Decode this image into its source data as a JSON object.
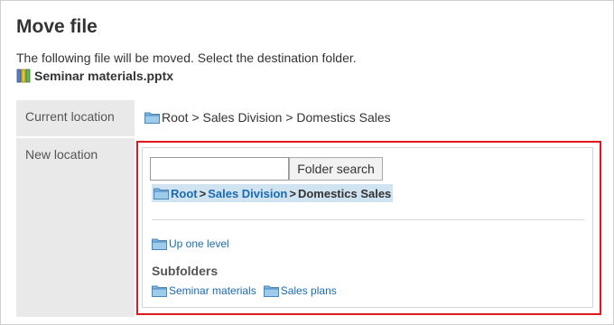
{
  "page": {
    "title": "Move file",
    "description": "The following file will be moved. Select the destination folder.",
    "file_name": "Seminar materials.pptx",
    "file_icon": "presentation-file-icon"
  },
  "current_location": {
    "label": "Current location",
    "path": "Root > Sales Division > Domestics Sales",
    "folder_icon": "folder-icon"
  },
  "new_location": {
    "label": "New location",
    "search": {
      "value": "",
      "placeholder": "",
      "button_label": "Folder search"
    },
    "breadcrumb": {
      "items": [
        {
          "label": "Root",
          "link": true
        },
        {
          "label": "Sales Division",
          "link": true
        },
        {
          "label": "Domestics Sales",
          "link": false
        }
      ],
      "separator": ">"
    },
    "up_one_level": "Up one level",
    "subfolders_heading": "Subfolders",
    "subfolders": [
      {
        "label": "Seminar materials"
      },
      {
        "label": "Sales plans"
      }
    ]
  },
  "colors": {
    "highlight_border": "#e0181e",
    "link": "#1a6bb3",
    "label_bg": "#e9e9e9",
    "breadcrumb_bg": "#cfe3f0",
    "folder": "#7fb6e0"
  }
}
